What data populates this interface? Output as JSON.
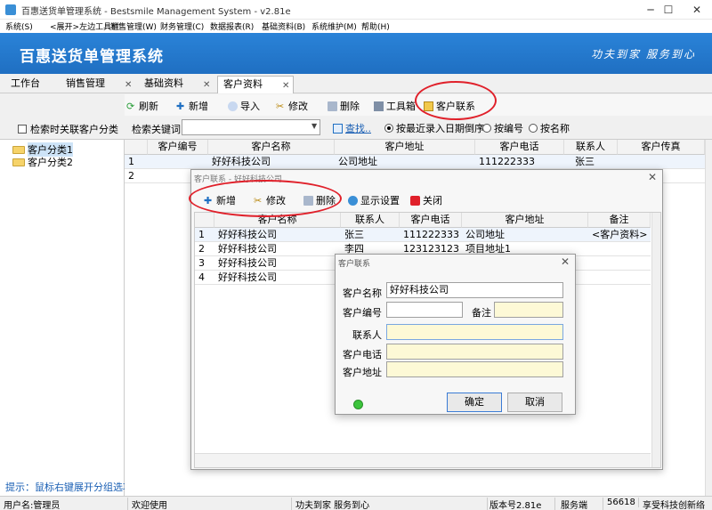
{
  "window": {
    "title": "百惠送货单管理系统 - Bestsmile Management System - v2.81e",
    "minimize": "─",
    "maximize": "☐",
    "close": "✕"
  },
  "menu": [
    "系统(S)",
    "<展开>左边工具栏",
    "销售管理(W)",
    "财务管理(C)",
    "数据报表(R)",
    "基础资料(B)",
    "系统维护(M)",
    "帮助(H)"
  ],
  "banner": {
    "title": "百惠送货单管理系统",
    "slogan": "功夫到家 服务到心"
  },
  "tabs": [
    {
      "label": "工作台",
      "closable": false
    },
    {
      "label": "销售管理",
      "closable": true
    },
    {
      "label": "基础资料",
      "closable": true
    },
    {
      "label": "客户资料",
      "closable": true,
      "active": true
    }
  ],
  "toolbar": {
    "refresh": "刷新",
    "add": "新增",
    "import": "导入",
    "edit": "修改",
    "delete": "删除",
    "toolbox": "工具箱",
    "contacts": "客户联系"
  },
  "left": {
    "check_label": "检索时关联客户分类",
    "tree": [
      "客户分类1",
      "客户分类2"
    ],
    "hint": "提示：鼠标右键展开分组选项"
  },
  "search": {
    "label": "检索关键词",
    "value": "",
    "find_button": "查找..",
    "sort_options": [
      {
        "label": "按最近录入日期倒序",
        "checked": true
      },
      {
        "label": "按编号",
        "checked": false
      },
      {
        "label": "按名称",
        "checked": false
      }
    ]
  },
  "main_grid": {
    "columns": [
      "客户编号",
      "客户名称",
      "客户地址",
      "客户电话",
      "联系人",
      "客户传真"
    ],
    "rows": [
      {
        "num": "1",
        "code": "",
        "name": "好好科技公司",
        "address": "公司地址",
        "phone": "111222333",
        "contact": "张三",
        "fax": ""
      },
      {
        "num": "2",
        "code": "",
        "name": "",
        "address": "",
        "phone": "",
        "contact": "",
        "fax": ""
      }
    ]
  },
  "contact_dialog": {
    "title": "客户联系 - 好好科技公司",
    "close": "✕",
    "toolbar": {
      "add": "新增",
      "edit": "修改",
      "delete": "删除",
      "display": "显示设置",
      "close": "关闭"
    },
    "columns": [
      "客户名称",
      "联系人",
      "客户电话",
      "客户地址",
      "备注"
    ],
    "rows": [
      {
        "num": "1",
        "name": "好好科技公司",
        "contact": "张三",
        "phone": "111222333",
        "address": "公司地址",
        "note": "<客户资料>"
      },
      {
        "num": "2",
        "name": "好好科技公司",
        "contact": "李四",
        "phone": "123123123",
        "address": "项目地址1",
        "note": ""
      },
      {
        "num": "3",
        "name": "好好科技公司",
        "contact": "",
        "phone": "",
        "address": "",
        "note": ""
      },
      {
        "num": "4",
        "name": "好好科技公司",
        "contact": "",
        "phone": "",
        "address": "",
        "note": ""
      }
    ]
  },
  "form_dialog": {
    "title": "客户联系",
    "close": "✕",
    "labels": {
      "name": "客户名称",
      "code": "客户编号",
      "note": "备注",
      "contact": "联系人",
      "phone": "客户电话",
      "address": "客户地址"
    },
    "values": {
      "name": "好好科技公司",
      "code": "",
      "note": "",
      "contact": "",
      "phone": "",
      "address": ""
    },
    "ok": "确定",
    "cancel": "取消"
  },
  "statusbar": {
    "user": "用户名:管理员",
    "welcome": "欢迎使用",
    "slogan": "功夫到家 服务到心",
    "version": "版本号2.81e",
    "server": "服务端",
    "port": "56618",
    "company": "享受科技创新络"
  },
  "colors": {
    "banner": "#1f6fc2",
    "annotation": "#e0202a",
    "input_yellow": "#fdf9d6",
    "hint": "#1a5fb4"
  }
}
